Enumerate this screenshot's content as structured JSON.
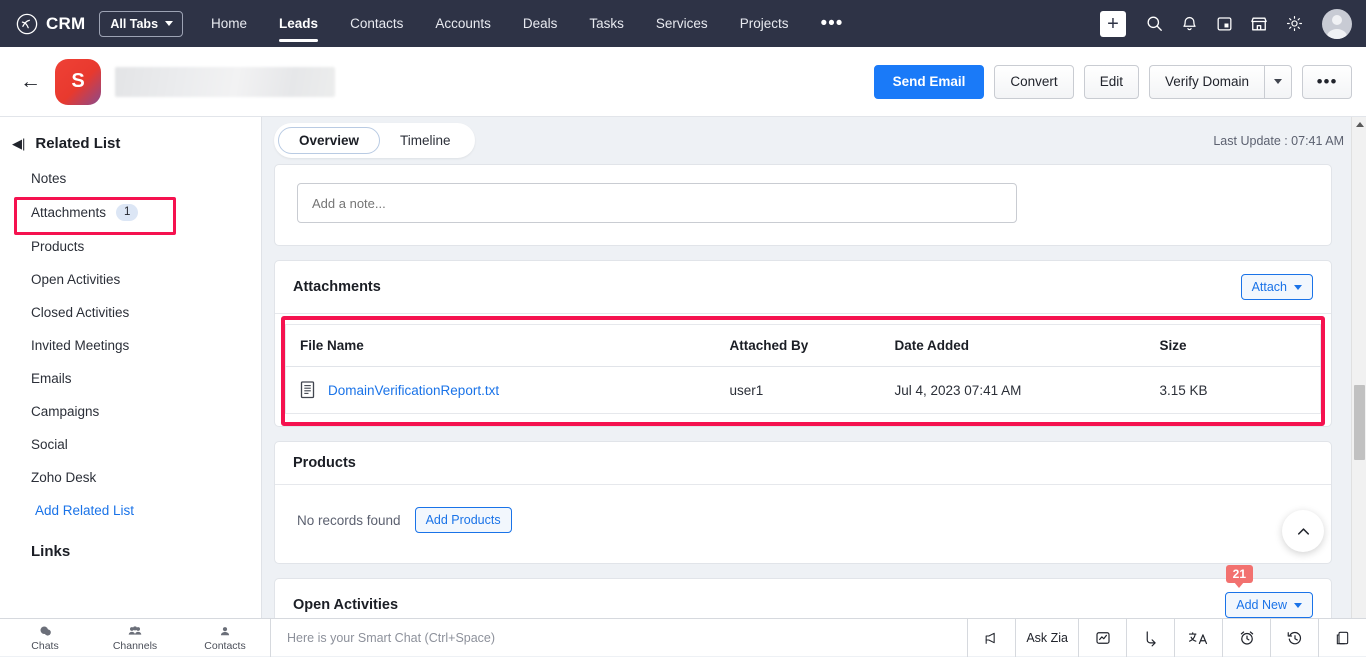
{
  "topnav": {
    "brand": "CRM",
    "all_tabs_label": "All Tabs",
    "items": [
      {
        "label": "Home",
        "active": false
      },
      {
        "label": "Leads",
        "active": true
      },
      {
        "label": "Contacts",
        "active": false
      },
      {
        "label": "Accounts",
        "active": false
      },
      {
        "label": "Deals",
        "active": false
      },
      {
        "label": "Tasks",
        "active": false
      },
      {
        "label": "Services",
        "active": false
      },
      {
        "label": "Projects",
        "active": false
      }
    ],
    "more_label": "•••",
    "icons": [
      "add-icon",
      "search-icon",
      "notifications-icon",
      "calendar-icon",
      "marketplace-icon",
      "settings-icon",
      "user-avatar"
    ]
  },
  "record_header": {
    "back_label": "←",
    "avatar_initial": "S",
    "record_name_redacted": "",
    "buttons": {
      "send_email": "Send Email",
      "convert": "Convert",
      "edit": "Edit",
      "verify_domain": "Verify Domain",
      "more": "•••"
    }
  },
  "sidebar": {
    "title": "Related List",
    "items": [
      {
        "label": "Notes",
        "badge": null,
        "highlighted": false
      },
      {
        "label": "Attachments",
        "badge": "1",
        "highlighted": true
      },
      {
        "label": "Products",
        "badge": null,
        "highlighted": false
      },
      {
        "label": "Open Activities",
        "badge": null,
        "highlighted": false
      },
      {
        "label": "Closed Activities",
        "badge": null,
        "highlighted": false
      },
      {
        "label": "Invited Meetings",
        "badge": null,
        "highlighted": false
      },
      {
        "label": "Emails",
        "badge": null,
        "highlighted": false
      },
      {
        "label": "Campaigns",
        "badge": null,
        "highlighted": false
      },
      {
        "label": "Social",
        "badge": null,
        "highlighted": false
      },
      {
        "label": "Zoho Desk",
        "badge": null,
        "highlighted": false
      }
    ],
    "add_related_list": "Add Related List",
    "links_heading": "Links"
  },
  "main": {
    "tabs": [
      {
        "label": "Overview",
        "active": true
      },
      {
        "label": "Timeline",
        "active": false
      }
    ],
    "last_update": "Last Update : 07:41 AM",
    "note": {
      "placeholder": "Add a note..."
    },
    "attachments": {
      "title": "Attachments",
      "attach_button": "Attach",
      "columns": [
        "File Name",
        "Attached By",
        "Date Added",
        "Size"
      ],
      "rows": [
        {
          "file_name": "DomainVerificationReport.txt",
          "attached_by": "user1",
          "date_added": "Jul 4, 2023 07:41 AM",
          "size": "3.15 KB"
        }
      ]
    },
    "products": {
      "title": "Products",
      "empty_text": "No records found",
      "add_button": "Add Products"
    },
    "open_activities": {
      "title": "Open Activities",
      "add_new_button": "Add New",
      "badge": "21"
    },
    "scroll_top_icon": "chevron-up-icon"
  },
  "bottombar": {
    "chat_items": [
      {
        "label": "Chats",
        "icon": "chat-icon"
      },
      {
        "label": "Channels",
        "icon": "channels-icon"
      },
      {
        "label": "Contacts",
        "icon": "contacts-icon"
      }
    ],
    "smart_chat_placeholder": "Here is your Smart Chat (Ctrl+Space)",
    "right_items": [
      {
        "label": "",
        "icon": "announcement-icon"
      },
      {
        "label": "Ask Zia",
        "icon": "ask-zia"
      },
      {
        "label": "",
        "icon": "analytics-icon"
      },
      {
        "label": "",
        "icon": "share-icon"
      },
      {
        "label": "",
        "icon": "translate-icon"
      },
      {
        "label": "",
        "icon": "alarm-icon"
      },
      {
        "label": "",
        "icon": "history-icon"
      },
      {
        "label": "",
        "icon": "notes-icon"
      }
    ]
  },
  "colors": {
    "nav_bg": "#2e3346",
    "primary_blue": "#1a7af8",
    "link_blue": "#1a73e8",
    "highlight_red": "#f5124f",
    "badge_red": "#f2716f"
  }
}
